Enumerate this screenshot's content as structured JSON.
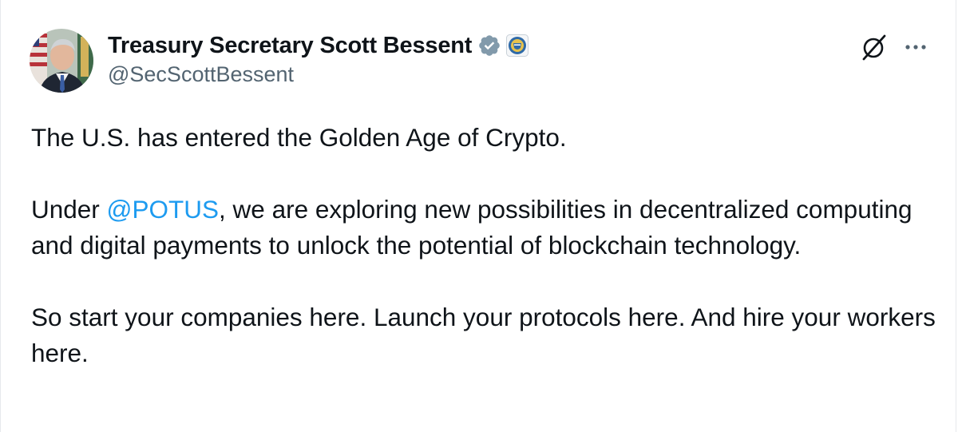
{
  "author": {
    "display_name": "Treasury Secretary Scott Bessent",
    "handle": "@SecScottBessent",
    "verified_icon": "verified-badge-icon",
    "affiliate_icon": "treasury-seal-icon",
    "avatar_icon": "avatar"
  },
  "header_actions": {
    "grok_icon": "grok-icon",
    "more_icon": "more-options-icon"
  },
  "tweet": {
    "line1": "The U.S. has entered the Golden Age of Crypto.",
    "para2_prefix": "Under ",
    "mention": "@POTUS",
    "para2_suffix": ", we are exploring new possibilities in decentralized computing and digital payments to unlock the potential of blockchain technology.",
    "para3": "So start your companies here. Launch your protocols here. And hire your workers here."
  },
  "colors": {
    "accent": "#1d9bf0",
    "text": "#0f1419",
    "secondary": "#536471",
    "verified": "#829aab"
  }
}
